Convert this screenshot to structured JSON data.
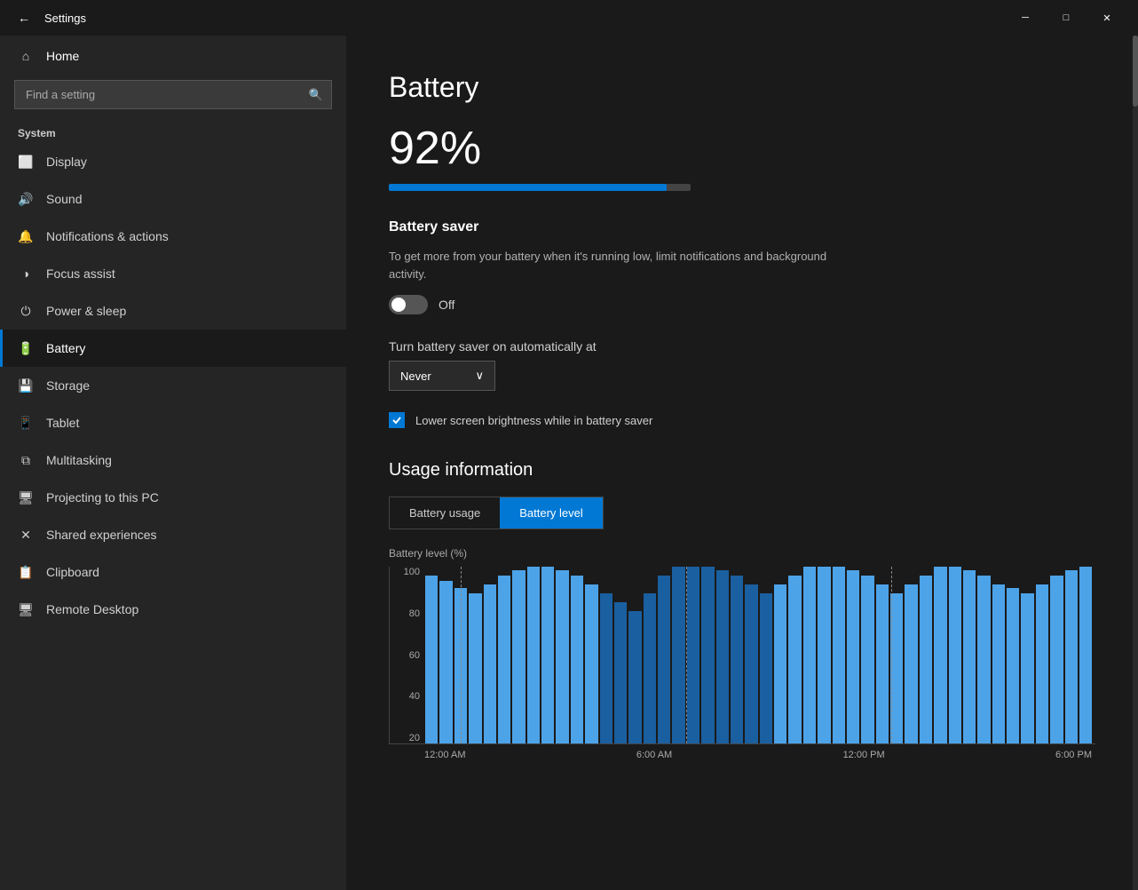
{
  "titlebar": {
    "back_label": "←",
    "title": "Settings",
    "minimize": "─",
    "maximize": "□",
    "close": "✕"
  },
  "sidebar": {
    "home_label": "Home",
    "search_placeholder": "Find a setting",
    "search_icon": "🔍",
    "section_label": "System",
    "items": [
      {
        "id": "display",
        "label": "Display",
        "icon": "display"
      },
      {
        "id": "sound",
        "label": "Sound",
        "icon": "sound"
      },
      {
        "id": "notifications",
        "label": "Notifications & actions",
        "icon": "notifications"
      },
      {
        "id": "focus",
        "label": "Focus assist",
        "icon": "focus"
      },
      {
        "id": "power",
        "label": "Power & sleep",
        "icon": "power"
      },
      {
        "id": "battery",
        "label": "Battery",
        "icon": "battery",
        "active": true
      },
      {
        "id": "storage",
        "label": "Storage",
        "icon": "storage"
      },
      {
        "id": "tablet",
        "label": "Tablet",
        "icon": "tablet"
      },
      {
        "id": "multitasking",
        "label": "Multitasking",
        "icon": "multitasking"
      },
      {
        "id": "projecting",
        "label": "Projecting to this PC",
        "icon": "projecting"
      },
      {
        "id": "shared",
        "label": "Shared experiences",
        "icon": "shared"
      },
      {
        "id": "clipboard",
        "label": "Clipboard",
        "icon": "clipboard"
      },
      {
        "id": "remote",
        "label": "Remote Desktop",
        "icon": "remote"
      }
    ]
  },
  "content": {
    "page_title": "Battery",
    "battery_percent": "92%",
    "battery_fill_pct": 92,
    "battery_saver": {
      "section_title": "Battery saver",
      "description": "To get more from your battery when it's running low, limit notifications and background activity.",
      "toggle_state": "off",
      "toggle_label": "Off",
      "auto_label": "Turn battery saver on automatically at",
      "dropdown_value": "Never",
      "checkbox_label": "Lower screen brightness while in battery saver",
      "checkbox_checked": true
    },
    "usage_info": {
      "section_title": "Usage information",
      "tab_battery_usage": "Battery usage",
      "tab_battery_level": "Battery level",
      "active_tab": "Battery level",
      "chart_y_label": "Battery level (%)",
      "chart_y_ticks": [
        "100",
        "80",
        "60",
        "40",
        "20"
      ],
      "chart_x_ticks": [
        "12:00 AM",
        "6:00 AM",
        "12:00 PM",
        "6:00 PM"
      ],
      "bars": [
        95,
        92,
        88,
        85,
        90,
        95,
        98,
        100,
        100,
        98,
        95,
        90,
        85,
        80,
        75,
        85,
        95,
        100,
        100,
        100,
        98,
        95,
        90,
        85,
        90,
        95,
        100,
        100,
        100,
        98,
        95,
        90,
        85,
        90,
        95,
        100,
        100,
        98,
        95,
        90,
        88,
        85,
        90,
        95,
        98,
        100
      ]
    }
  }
}
